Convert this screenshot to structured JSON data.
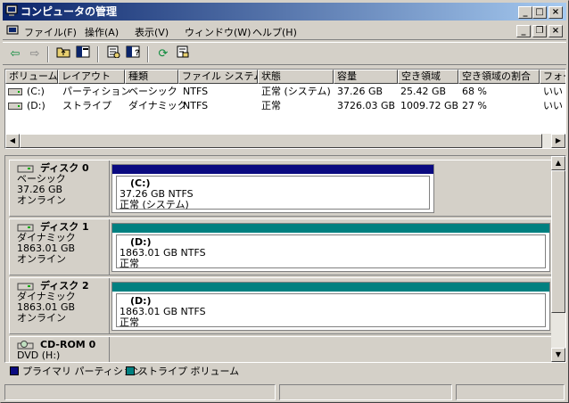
{
  "window": {
    "title": "コンピュータの管理"
  },
  "colors": {
    "primary": "#0a0a80",
    "striped": "#008080",
    "title_bar": "#0a246a"
  },
  "menu": {
    "items": [
      "ファイル(F)",
      "操作(A)",
      "表示(V)",
      "ウィンドウ(W)",
      "ヘルプ(H)"
    ]
  },
  "toolbar": {
    "icons": [
      "back-arrow-icon",
      "forward-arrow-icon",
      "up-folder-icon",
      "show-hide-tree-icon",
      "properties-icon",
      "help-icon",
      "refresh-icon",
      "export-icon"
    ]
  },
  "volumes": {
    "columns": [
      "ボリューム",
      "レイアウト",
      "種類",
      "ファイル システム",
      "状態",
      "容量",
      "空き領域",
      "空き領域の割合",
      "フォー"
    ],
    "rows": [
      [
        "(C:)",
        "パーティション",
        "ベーシック",
        "NTFS",
        "正常 (システム)",
        "37.26 GB",
        "25.42 GB",
        "68 %",
        "いい"
      ],
      [
        "(D:)",
        "ストライプ",
        "ダイナミック",
        "NTFS",
        "正常",
        "3726.03 GB",
        "1009.72 GB",
        "27 %",
        "いい"
      ]
    ]
  },
  "disks": [
    {
      "name": "ディスク 0",
      "type": "ベーシック",
      "size": "37.26 GB",
      "status": "オンライン",
      "vol_label": "(C:)",
      "vol_size": "37.26 GB NTFS",
      "vol_status": "正常 (システム)",
      "color": "#0a0a80"
    },
    {
      "name": "ディスク 1",
      "type": "ダイナミック",
      "size": "1863.01 GB",
      "status": "オンライン",
      "vol_label": "(D:)",
      "vol_size": "1863.01 GB NTFS",
      "vol_status": "正常",
      "color": "#008080"
    },
    {
      "name": "ディスク 2",
      "type": "ダイナミック",
      "size": "1863.01 GB",
      "status": "オンライン",
      "vol_label": "(D:)",
      "vol_size": "1863.01 GB NTFS",
      "vol_status": "正常",
      "color": "#008080"
    },
    {
      "name": "CD-ROM 0",
      "type": "DVD (H:)"
    }
  ],
  "legend": {
    "primary": "プライマリ パーティション",
    "striped": "ストライプ ボリューム"
  }
}
